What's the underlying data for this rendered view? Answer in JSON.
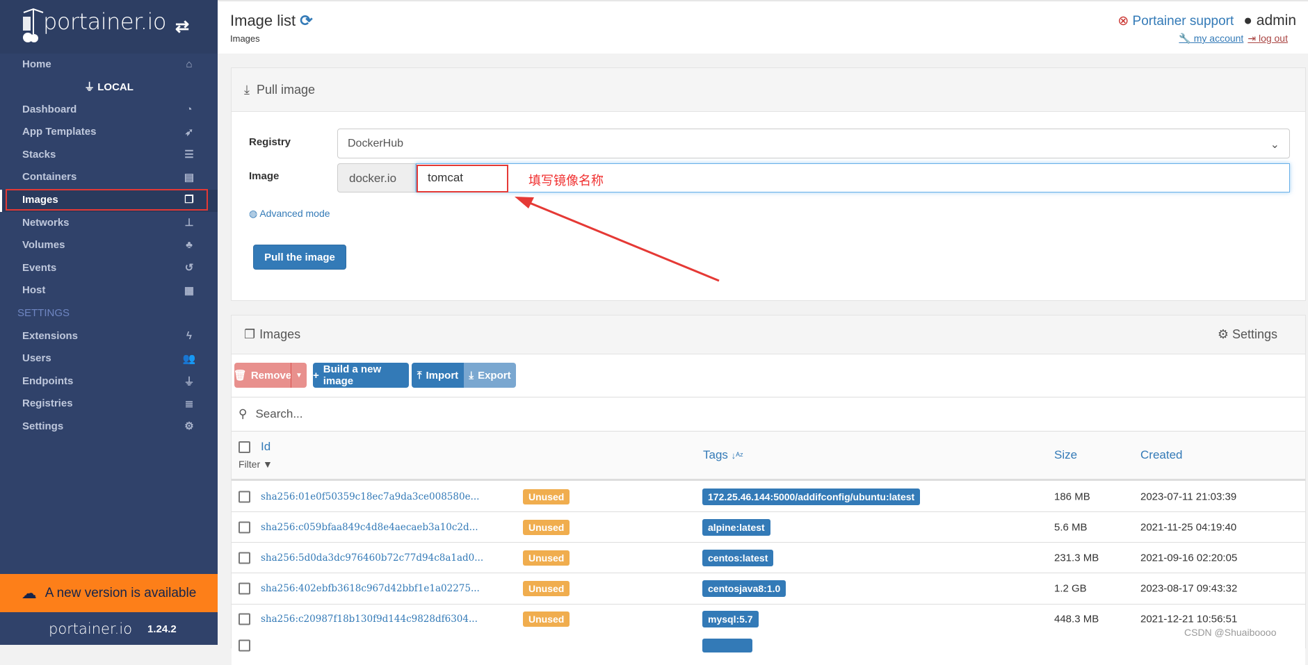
{
  "brand": {
    "logo": "portainer.io",
    "version": "1.24.2"
  },
  "sidebar": {
    "home": "Home",
    "endpoint": "LOCAL",
    "items": [
      {
        "label": "Dashboard",
        "icon": "dashboard-icon"
      },
      {
        "label": "App Templates",
        "icon": "rocket-icon"
      },
      {
        "label": "Stacks",
        "icon": "list-icon"
      },
      {
        "label": "Containers",
        "icon": "server-icon"
      },
      {
        "label": "Images",
        "icon": "clone-icon",
        "active": true
      },
      {
        "label": "Networks",
        "icon": "sitemap-icon"
      },
      {
        "label": "Volumes",
        "icon": "cubes-icon"
      },
      {
        "label": "Events",
        "icon": "history-icon"
      },
      {
        "label": "Host",
        "icon": "th-icon"
      }
    ],
    "settings_header": "SETTINGS",
    "settings_items": [
      {
        "label": "Extensions",
        "icon": "bolt-icon"
      },
      {
        "label": "Users",
        "icon": "users-icon"
      },
      {
        "label": "Endpoints",
        "icon": "plug-icon"
      },
      {
        "label": "Registries",
        "icon": "database-icon"
      },
      {
        "label": "Settings",
        "icon": "cogs-icon"
      }
    ],
    "update_banner": "A new version is available"
  },
  "header": {
    "title": "Image list",
    "breadcrumb": "Images",
    "support": "Portainer support",
    "user": "admin",
    "my_account": " my account ",
    "log_out": " log out"
  },
  "pull": {
    "title": "Pull image",
    "registry_label": "Registry",
    "registry_value": "DockerHub",
    "image_label": "Image",
    "prefix": "docker.io",
    "image_value": "tomcat",
    "annotation": "填写镜像名称",
    "advanced": "Advanced mode",
    "button": "Pull the image"
  },
  "images": {
    "title": "Images",
    "settings": "Settings",
    "remove": "Remove",
    "build": "Build a new image",
    "import": "Import",
    "export": "Export",
    "search_placeholder": "Search...",
    "columns": {
      "id": "Id",
      "filter": "Filter",
      "tags": "Tags",
      "size": "Size",
      "created": "Created"
    },
    "rows": [
      {
        "id": "sha256:01e0f50359c18ec7a9da3ce008580e...",
        "status": "Unused",
        "tag": "172.25.46.144:5000/addifconfig/ubuntu:latest",
        "size": "186 MB",
        "created": "2023-07-11 21:03:39"
      },
      {
        "id": "sha256:c059bfaa849c4d8e4aecaeb3a10c2d...",
        "status": "Unused",
        "tag": "alpine:latest",
        "size": "5.6 MB",
        "created": "2021-11-25 04:19:40"
      },
      {
        "id": "sha256:5d0da3dc976460b72c77d94c8a1ad0...",
        "status": "Unused",
        "tag": "centos:latest",
        "size": "231.3 MB",
        "created": "2021-09-16 02:20:05"
      },
      {
        "id": "sha256:402ebfb3618c967d42bbf1e1a02275...",
        "status": "Unused",
        "tag": "centosjava8:1.0",
        "size": "1.2 GB",
        "created": "2023-08-17 09:43:32"
      },
      {
        "id": "sha256:c20987f18b130f9d144c9828df6304...",
        "status": "Unused",
        "tag": "mysql:5.7",
        "size": "448.3 MB",
        "created": "2021-12-21 10:56:51"
      }
    ]
  },
  "watermark": "CSDN @Shuaiboooo",
  "colors": {
    "sidebar": "#30426a",
    "primary": "#337ab7",
    "danger": "#d9534f",
    "warning": "#f0ad4e",
    "banner": "#fd7f19"
  }
}
